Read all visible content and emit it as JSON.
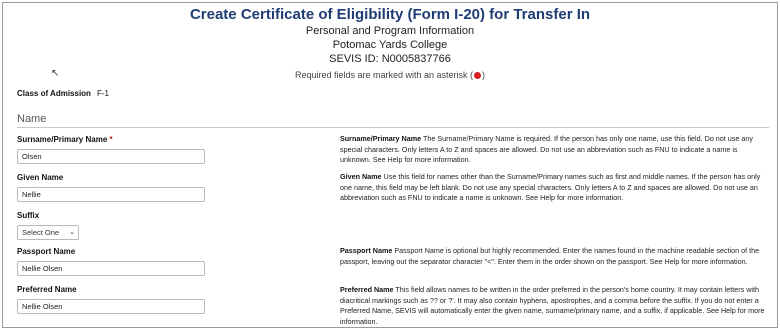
{
  "header": {
    "title": "Create Certificate of Eligibility (Form I-20) for Transfer In",
    "subtitle": "Personal and Program Information",
    "school": "Potomac Yards College",
    "sevis_id": "SEVIS ID: N0005837766",
    "required_note_prefix": "Required fields are marked with an asterisk (",
    "required_note_suffix": ")"
  },
  "class_of_admission": {
    "label": "Class of Admission",
    "value": "F-1"
  },
  "section_name": "Name",
  "fields": {
    "surname": {
      "label": "Surname/Primary Name",
      "required_mark": "*",
      "value": "Olsen"
    },
    "given": {
      "label": "Given Name",
      "value": "Nellie"
    },
    "suffix": {
      "label": "Suffix",
      "value": "Select One"
    },
    "passport": {
      "label": "Passport Name",
      "value": "Nellie Olsen"
    },
    "preferred": {
      "label": "Preferred Name",
      "value": "Nellie Olsen"
    }
  },
  "help": {
    "surname": {
      "title": "Surname/Primary Name",
      "text": " The Surname/Primary Name is required. If the person has only one name, use this field. Do not use any special characters. Only letters A to Z and spaces are allowed. Do not use an abbreviation such as FNU to indicate a name is unknown. See Help for more information."
    },
    "given": {
      "title": "Given Name",
      "text": " Use this field for names other than the Surname/Primary names such as first and middle names. If the person has only one name, this field may be left blank. Do not use any special characters. Only letters A to Z and spaces are allowed. Do not use an abbreviation such as FNU to indicate a name is unknown. See Help for more information."
    },
    "passport": {
      "title": "Passport Name",
      "text": " Passport Name is optional but highly recommended. Enter the names found in the machine readable section of the passport, leaving out the separator character \"<\". Enter them in the order shown on the passport. See Help for more information."
    },
    "preferred": {
      "title": "Preferred Name",
      "text": " This field allows names to be written in the order preferred in the person's home country. It may contain letters with diacritical markings such as ?? or ?'. It may also contain hyphens, apostrophes, and a comma before the suffix. If you do not enter a Preferred Name, SEVIS will automatically enter the given name, surname/primary name, and a suffix, if applicable. See Help for more information."
    }
  },
  "colors": {
    "title": "#1f3c73",
    "required_marker": "#d61f1f"
  },
  "icons": {
    "cursor": "mouse-pointer-icon",
    "dropdown": "chevron-down-icon",
    "required": "red-dot-icon"
  }
}
